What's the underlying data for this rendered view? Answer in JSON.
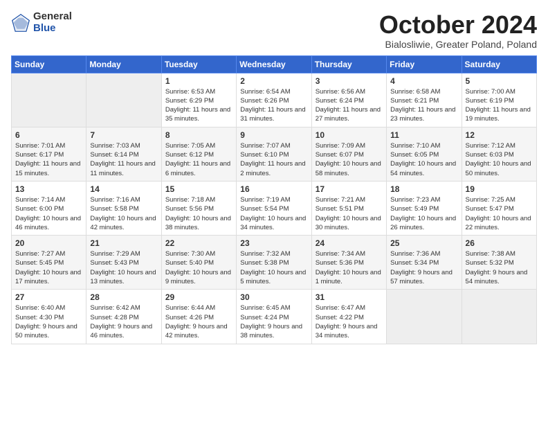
{
  "header": {
    "logo_general": "General",
    "logo_blue": "Blue",
    "month": "October 2024",
    "location": "Bialosliwie, Greater Poland, Poland"
  },
  "weekdays": [
    "Sunday",
    "Monday",
    "Tuesday",
    "Wednesday",
    "Thursday",
    "Friday",
    "Saturday"
  ],
  "weeks": [
    [
      {
        "day": "",
        "info": ""
      },
      {
        "day": "",
        "info": ""
      },
      {
        "day": "1",
        "info": "Sunrise: 6:53 AM\nSunset: 6:29 PM\nDaylight: 11 hours and 35 minutes."
      },
      {
        "day": "2",
        "info": "Sunrise: 6:54 AM\nSunset: 6:26 PM\nDaylight: 11 hours and 31 minutes."
      },
      {
        "day": "3",
        "info": "Sunrise: 6:56 AM\nSunset: 6:24 PM\nDaylight: 11 hours and 27 minutes."
      },
      {
        "day": "4",
        "info": "Sunrise: 6:58 AM\nSunset: 6:21 PM\nDaylight: 11 hours and 23 minutes."
      },
      {
        "day": "5",
        "info": "Sunrise: 7:00 AM\nSunset: 6:19 PM\nDaylight: 11 hours and 19 minutes."
      }
    ],
    [
      {
        "day": "6",
        "info": "Sunrise: 7:01 AM\nSunset: 6:17 PM\nDaylight: 11 hours and 15 minutes."
      },
      {
        "day": "7",
        "info": "Sunrise: 7:03 AM\nSunset: 6:14 PM\nDaylight: 11 hours and 11 minutes."
      },
      {
        "day": "8",
        "info": "Sunrise: 7:05 AM\nSunset: 6:12 PM\nDaylight: 11 hours and 6 minutes."
      },
      {
        "day": "9",
        "info": "Sunrise: 7:07 AM\nSunset: 6:10 PM\nDaylight: 11 hours and 2 minutes."
      },
      {
        "day": "10",
        "info": "Sunrise: 7:09 AM\nSunset: 6:07 PM\nDaylight: 10 hours and 58 minutes."
      },
      {
        "day": "11",
        "info": "Sunrise: 7:10 AM\nSunset: 6:05 PM\nDaylight: 10 hours and 54 minutes."
      },
      {
        "day": "12",
        "info": "Sunrise: 7:12 AM\nSunset: 6:03 PM\nDaylight: 10 hours and 50 minutes."
      }
    ],
    [
      {
        "day": "13",
        "info": "Sunrise: 7:14 AM\nSunset: 6:00 PM\nDaylight: 10 hours and 46 minutes."
      },
      {
        "day": "14",
        "info": "Sunrise: 7:16 AM\nSunset: 5:58 PM\nDaylight: 10 hours and 42 minutes."
      },
      {
        "day": "15",
        "info": "Sunrise: 7:18 AM\nSunset: 5:56 PM\nDaylight: 10 hours and 38 minutes."
      },
      {
        "day": "16",
        "info": "Sunrise: 7:19 AM\nSunset: 5:54 PM\nDaylight: 10 hours and 34 minutes."
      },
      {
        "day": "17",
        "info": "Sunrise: 7:21 AM\nSunset: 5:51 PM\nDaylight: 10 hours and 30 minutes."
      },
      {
        "day": "18",
        "info": "Sunrise: 7:23 AM\nSunset: 5:49 PM\nDaylight: 10 hours and 26 minutes."
      },
      {
        "day": "19",
        "info": "Sunrise: 7:25 AM\nSunset: 5:47 PM\nDaylight: 10 hours and 22 minutes."
      }
    ],
    [
      {
        "day": "20",
        "info": "Sunrise: 7:27 AM\nSunset: 5:45 PM\nDaylight: 10 hours and 17 minutes."
      },
      {
        "day": "21",
        "info": "Sunrise: 7:29 AM\nSunset: 5:43 PM\nDaylight: 10 hours and 13 minutes."
      },
      {
        "day": "22",
        "info": "Sunrise: 7:30 AM\nSunset: 5:40 PM\nDaylight: 10 hours and 9 minutes."
      },
      {
        "day": "23",
        "info": "Sunrise: 7:32 AM\nSunset: 5:38 PM\nDaylight: 10 hours and 5 minutes."
      },
      {
        "day": "24",
        "info": "Sunrise: 7:34 AM\nSunset: 5:36 PM\nDaylight: 10 hours and 1 minute."
      },
      {
        "day": "25",
        "info": "Sunrise: 7:36 AM\nSunset: 5:34 PM\nDaylight: 9 hours and 57 minutes."
      },
      {
        "day": "26",
        "info": "Sunrise: 7:38 AM\nSunset: 5:32 PM\nDaylight: 9 hours and 54 minutes."
      }
    ],
    [
      {
        "day": "27",
        "info": "Sunrise: 6:40 AM\nSunset: 4:30 PM\nDaylight: 9 hours and 50 minutes."
      },
      {
        "day": "28",
        "info": "Sunrise: 6:42 AM\nSunset: 4:28 PM\nDaylight: 9 hours and 46 minutes."
      },
      {
        "day": "29",
        "info": "Sunrise: 6:44 AM\nSunset: 4:26 PM\nDaylight: 9 hours and 42 minutes."
      },
      {
        "day": "30",
        "info": "Sunrise: 6:45 AM\nSunset: 4:24 PM\nDaylight: 9 hours and 38 minutes."
      },
      {
        "day": "31",
        "info": "Sunrise: 6:47 AM\nSunset: 4:22 PM\nDaylight: 9 hours and 34 minutes."
      },
      {
        "day": "",
        "info": ""
      },
      {
        "day": "",
        "info": ""
      }
    ]
  ]
}
